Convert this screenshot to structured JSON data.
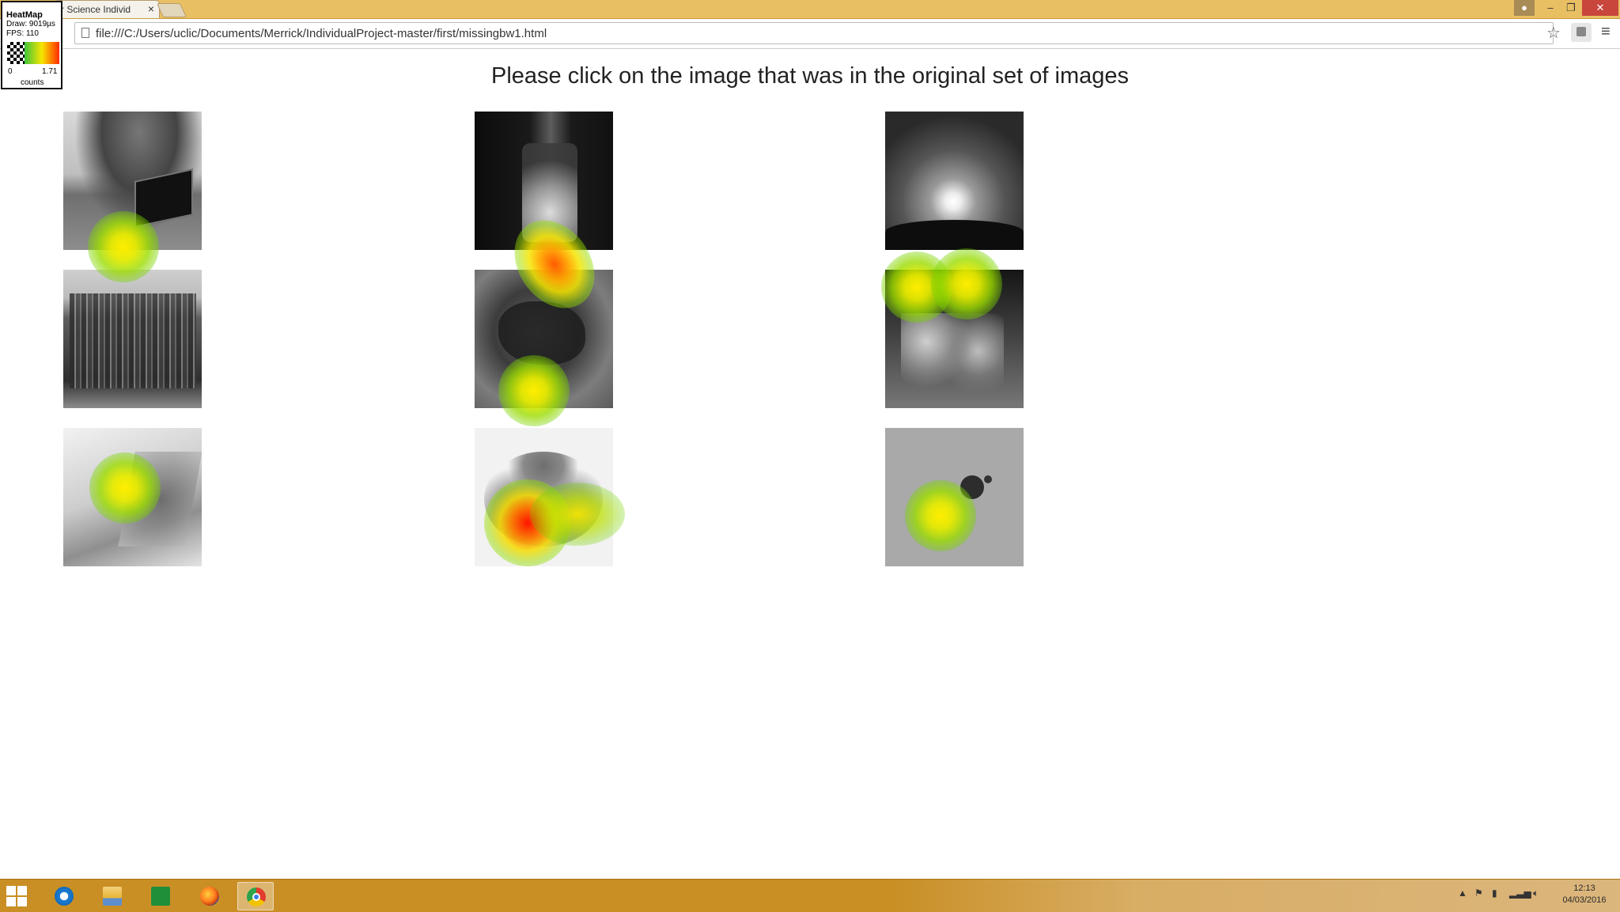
{
  "browser": {
    "tab_title": "r Science Individ",
    "tab_close": "×",
    "url": "file:///C:/Users/uclic/Documents/Merrick/IndividualProject-master/first/missingbw1.html",
    "window_controls": {
      "minimize": "–",
      "maximize": "❐",
      "close": "✕"
    },
    "star_icon": "star-icon",
    "menu_icon": "hamburger-menu-icon"
  },
  "heatmap_widget": {
    "title": "HeatMap",
    "draw": "Draw: 9019µs",
    "fps": "FPS: 110",
    "scale_min": "0",
    "scale_max": "1.71",
    "scale_unit": "counts"
  },
  "page": {
    "instruction": "Please click on the image that was in the original set of images",
    "images": [
      {
        "subject": "laptop on grass"
      },
      {
        "subject": "glass candy jars"
      },
      {
        "subject": "sunset over trees"
      },
      {
        "subject": "city skyline"
      },
      {
        "subject": "crab"
      },
      {
        "subject": "figurine reporters"
      },
      {
        "subject": "open book"
      },
      {
        "subject": "fruit pile"
      },
      {
        "subject": "small beetle"
      }
    ]
  },
  "taskbar": {
    "apps": [
      "Internet Explorer",
      "File Explorer",
      "Store",
      "Firefox",
      "Chrome"
    ],
    "active_app": "Chrome",
    "time": "12:13",
    "date": "04/03/2016"
  }
}
